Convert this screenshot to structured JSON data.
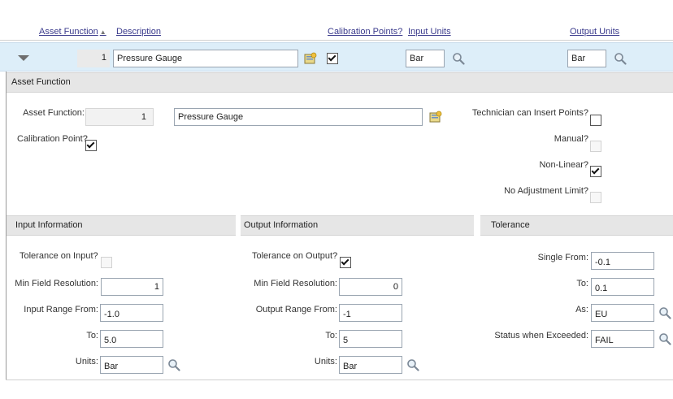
{
  "header": {
    "asset_function": "Asset Function",
    "description": "Description",
    "calibration_points": "Calibration Points?",
    "input_units": "Input Units",
    "output_units": "Output Units"
  },
  "row": {
    "index": "1",
    "description": "Pressure Gauge",
    "calibration_point_checked": true,
    "input_units": "Bar",
    "output_units": "Bar"
  },
  "asset_section": {
    "title": "Asset Function",
    "asset_function_label": "Asset Function:",
    "asset_function_value": "1",
    "description_value": "Pressure Gauge",
    "calibration_point_label": "Calibration Point?",
    "technician_label": "Technician can Insert Points?",
    "manual_label": "Manual?",
    "nonlinear_label": "Non-Linear?",
    "no_adjustment_label": "No Adjustment Limit?"
  },
  "input_section": {
    "title": "Input Information",
    "tolerance_label": "Tolerance on Input?",
    "min_field_label": "Min Field Resolution:",
    "min_field_value": "1",
    "range_from_label": "Input Range From:",
    "range_from_value": "-1.0",
    "to_label": "To:",
    "to_value": "5.0",
    "units_label": "Units:",
    "units_value": "Bar"
  },
  "output_section": {
    "title": "Output Information",
    "tolerance_label": "Tolerance on Output?",
    "min_field_label": "Min Field Resolution:",
    "min_field_value": "0",
    "range_from_label": "Output Range From:",
    "range_from_value": "-1",
    "to_label": "To:",
    "to_value": "5",
    "units_label": "Units:",
    "units_value": "Bar"
  },
  "tolerance_section": {
    "title": "Tolerance",
    "single_from_label": "Single From:",
    "single_from_value": "-0.1",
    "to_label": "To:",
    "to_value": "0.1",
    "as_label": "As:",
    "as_value": "EU",
    "status_label": "Status when Exceeded:",
    "status_value": "FAIL"
  },
  "colors": {
    "row_band": "#ddeef9",
    "section_header": "#e6e6e6",
    "link": "#3a3a8c"
  }
}
